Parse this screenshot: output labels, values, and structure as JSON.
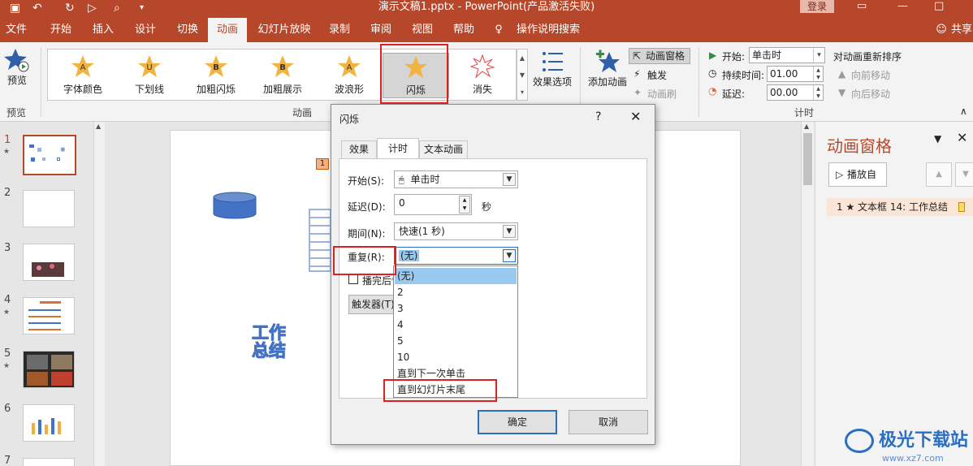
{
  "window": {
    "title": "演示文稿1.pptx - PowerPoint(产品激活失败)",
    "login": "登录",
    "quick_access": [
      "保存",
      "撤销",
      "重做",
      "从头开始",
      "预览",
      "自定义"
    ]
  },
  "tabs": [
    "文件",
    "开始",
    "插入",
    "设计",
    "切换",
    "动画",
    "幻灯片放映",
    "录制",
    "审阅",
    "视图",
    "帮助"
  ],
  "tell_me": "操作说明搜索",
  "share": "共享",
  "ribbon": {
    "preview": {
      "label": "预览",
      "group": "预览"
    },
    "animations": [
      "字体颜色",
      "下划线",
      "加粗闪烁",
      "加粗展示",
      "波浪形",
      "闪烁",
      "消失"
    ],
    "selected_animation": "闪烁",
    "effect_options": "效果选项",
    "animation_group": "动画",
    "add_animation": "添加动画",
    "animation_pane": "动画窗格",
    "trigger": "触发",
    "animation_painter": "动画刷",
    "start_label": "开始:",
    "start_value": "单击时",
    "duration_label": "持续时间:",
    "duration_value": "01.00",
    "delay_label": "延迟:",
    "delay_value": "00.00",
    "timing_group": "计时",
    "reorder_title": "对动画重新排序",
    "move_earlier": "向前移动",
    "move_later": "向后移动"
  },
  "slides": [
    {
      "num": "1",
      "star": "★"
    },
    {
      "num": "2",
      "star": ""
    },
    {
      "num": "3",
      "star": ""
    },
    {
      "num": "4",
      "star": "★"
    },
    {
      "num": "5",
      "star": "★"
    },
    {
      "num": "6",
      "star": ""
    },
    {
      "num": "7",
      "star": ""
    }
  ],
  "slide_content": {
    "anim_tag": "1",
    "wordart": "工作总结"
  },
  "animation_pane": {
    "title": "动画窗格",
    "play_button": "播放自",
    "entry": "1 ★ 文本框 14: 工作总结"
  },
  "dialog": {
    "title": "闪烁",
    "help": "?",
    "tabs": [
      "效果",
      "计时",
      "文本动画"
    ],
    "active_tab": "计时",
    "start_label": "开始(S):",
    "start_value": "单击时",
    "delay_label": "延迟(D):",
    "delay_value": "0",
    "delay_unit": "秒",
    "duration_label": "期间(N):",
    "duration_value": "快速(1 秒)",
    "repeat_label": "重复(R):",
    "repeat_value": "(无)",
    "rewind_label": "播完后快退(W)",
    "trigger_button": "触发器(T)",
    "repeat_options": [
      "(无)",
      "2",
      "3",
      "4",
      "5",
      "10",
      "直到下一次单击",
      "直到幻灯片末尾"
    ],
    "ok": "确定",
    "cancel": "取消"
  },
  "watermark": {
    "brand": "极光下载站",
    "url": "www.xz7.com"
  },
  "colors": {
    "accent": "#b7472a",
    "highlight": "#e02020",
    "selection": "#99c9ef"
  }
}
